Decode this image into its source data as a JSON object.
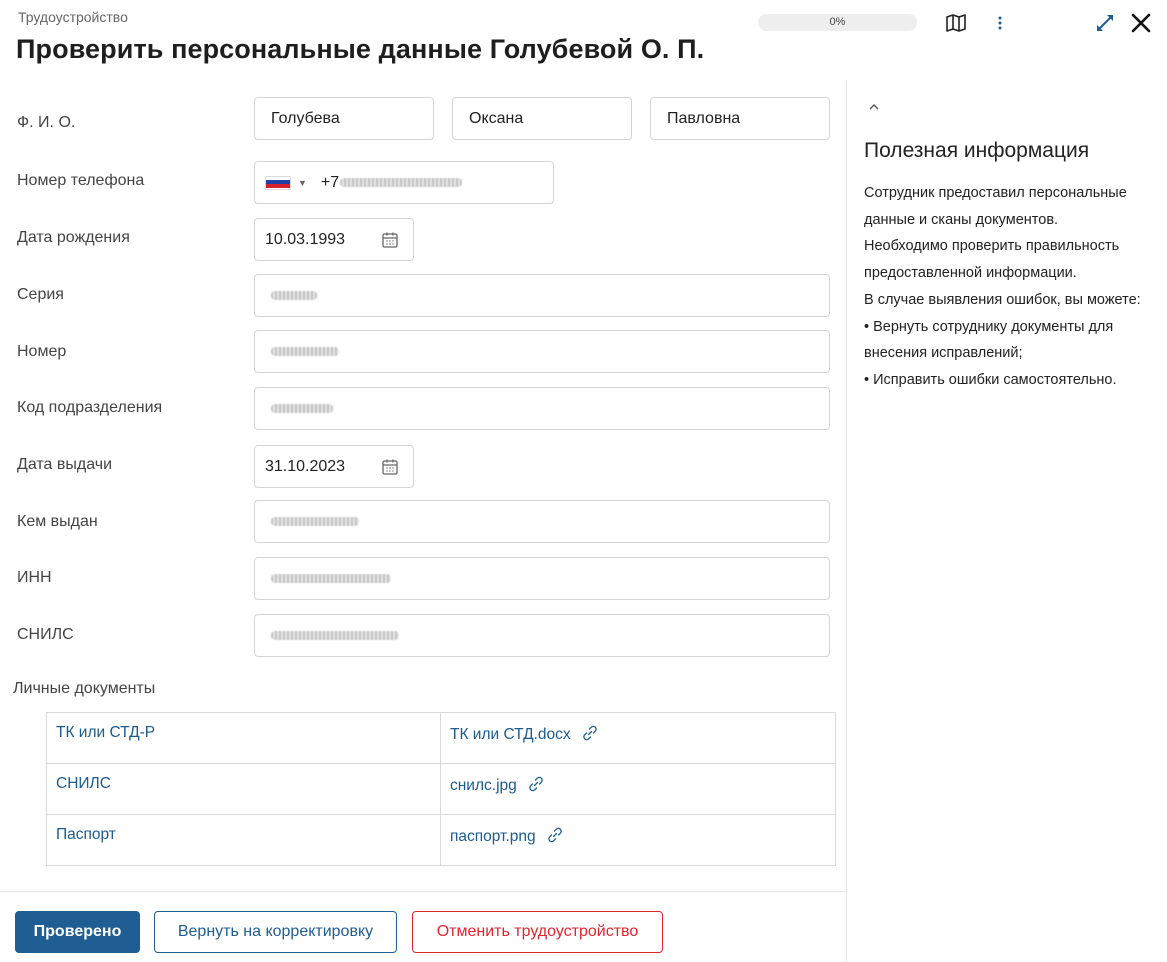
{
  "header": {
    "breadcrumb": "Трудоустройство",
    "title": "Проверить персональные данные Голубевой О. П.",
    "progress_label": "0%",
    "progress_value": 0
  },
  "icons": {
    "map": "map-icon",
    "more": "more-vertical-icon",
    "expand": "expand-icon",
    "close": "close-icon",
    "calendar": "calendar-icon",
    "link": "link-icon",
    "chevron": "chevron-up-icon"
  },
  "form": {
    "fio": {
      "label": "Ф. И. О.",
      "last_name": "Голубева",
      "first_name": "Оксана",
      "middle_name": "Павловна"
    },
    "phone": {
      "label": "Номер телефона",
      "prefix": "+7"
    },
    "birth_date": {
      "label": "Дата рождения",
      "value": "10.03.1993"
    },
    "series": {
      "label": "Серия"
    },
    "number": {
      "label": "Номер"
    },
    "division_code": {
      "label": "Код подразделения"
    },
    "issue_date": {
      "label": "Дата выдачи",
      "value": "31.10.2023"
    },
    "issued_by": {
      "label": "Кем выдан"
    },
    "inn": {
      "label": "ИНН"
    },
    "snils": {
      "label": "СНИЛС"
    }
  },
  "documents": {
    "label": "Личные документы",
    "rows": [
      {
        "name": "ТК или СТД-Р",
        "file": "ТК или СТД.docx"
      },
      {
        "name": "СНИЛС",
        "file": "снилс.jpg"
      },
      {
        "name": "Паспорт",
        "file": "паспорт.png"
      }
    ]
  },
  "actions": {
    "verified": "Проверено",
    "return": "Вернуть на корректировку",
    "cancel": "Отменить трудоустройство"
  },
  "aside": {
    "title": "Полезная информация",
    "lines": [
      "Сотрудник предоставил персональные",
      "данные и сканы документов.",
      "Необходимо проверить правильность",
      "предоставленной информации.",
      "В случае выявления ошибок, вы можете:",
      "• Вернуть сотруднику документы для",
      "внесения исправлений;",
      "• Исправить ошибки самостоятельно."
    ]
  },
  "colors": {
    "primary": "#1f5d92",
    "danger": "#e0262b",
    "link": "#1b5b8f",
    "border": "#d4d4d4"
  }
}
